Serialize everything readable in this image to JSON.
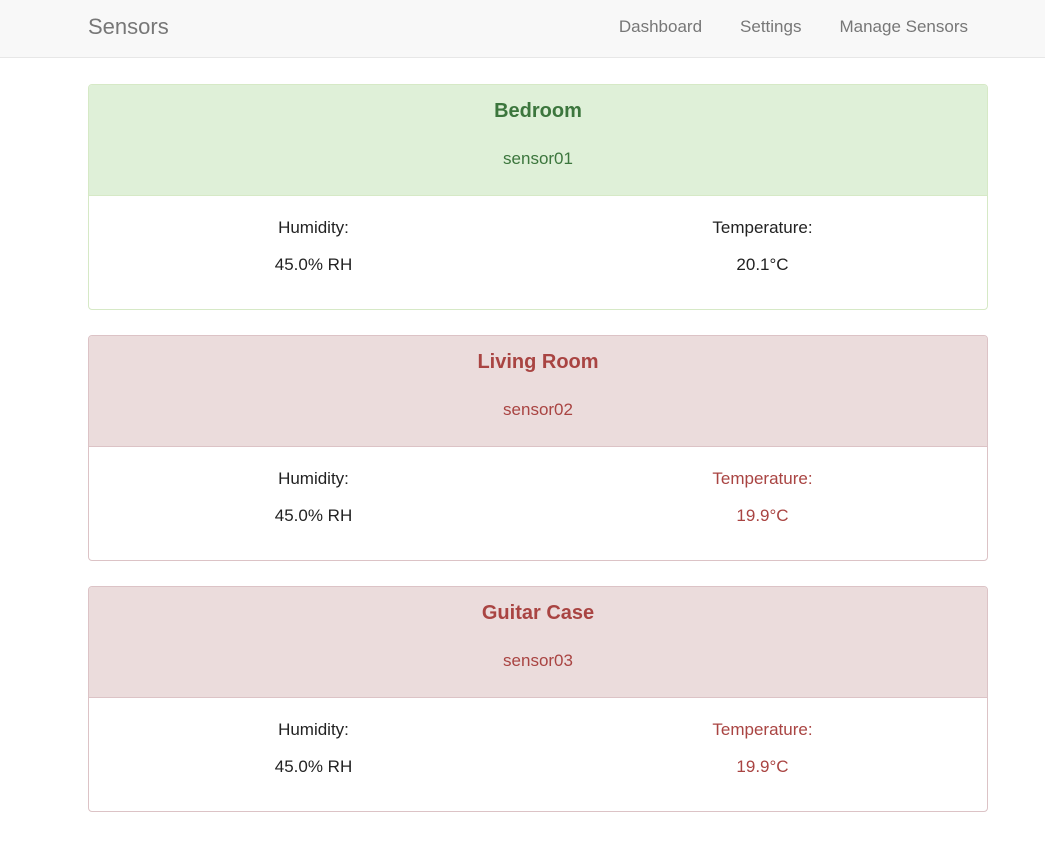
{
  "navbar": {
    "brand": "Sensors",
    "links": [
      "Dashboard",
      "Settings",
      "Manage Sensors"
    ]
  },
  "colors": {
    "ok_header_bg": "#dff0d8",
    "ok_text": "#3c763d",
    "alert_header_bg": "#ebdcdc",
    "alert_text": "#a94442"
  },
  "sensors": [
    {
      "name": "Bedroom",
      "id": "sensor01",
      "status": "ok",
      "humidity_label": "Humidity:",
      "humidity_value": "45.0% RH",
      "temperature_label": "Temperature:",
      "temperature_value": "20.1°C"
    },
    {
      "name": "Living Room",
      "id": "sensor02",
      "status": "alert",
      "humidity_label": "Humidity:",
      "humidity_value": "45.0% RH",
      "temperature_label": "Temperature:",
      "temperature_value": "19.9°C"
    },
    {
      "name": "Guitar Case",
      "id": "sensor03",
      "status": "alert",
      "humidity_label": "Humidity:",
      "humidity_value": "45.0% RH",
      "temperature_label": "Temperature:",
      "temperature_value": "19.9°C"
    }
  ]
}
